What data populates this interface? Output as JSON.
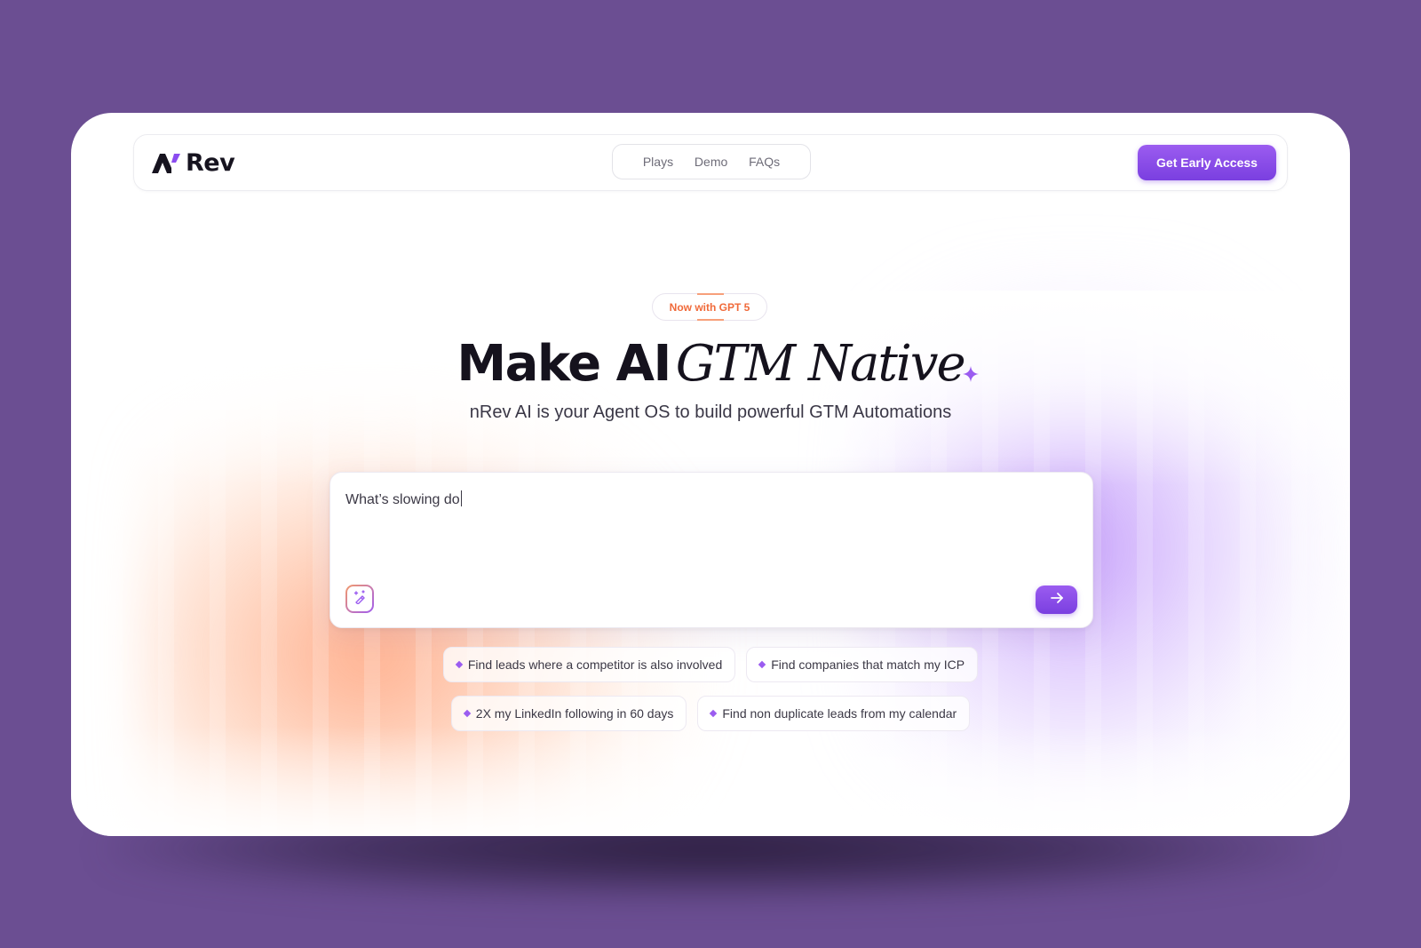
{
  "nav": {
    "logo_text": "Rev",
    "links": [
      "Plays",
      "Demo",
      "FAQs"
    ],
    "cta_label": "Get Early Access"
  },
  "hero": {
    "badge": "Now with GPT 5",
    "headline_main": "Make AI",
    "headline_accent": "GTM Native",
    "subhead": "nRev AI is your Agent OS to build powerful GTM Automations"
  },
  "prompt": {
    "value": "What’s slowing do"
  },
  "suggestions": [
    "Find leads where a competitor is also involved",
    "Find companies that match my ICP",
    "2X my LinkedIn following in 60 days",
    "Find non duplicate leads from my calendar"
  ],
  "colors": {
    "background": "#6b4e92",
    "accent": "#8b4cf0",
    "badge_text": "#f06a3a",
    "headline": "#15121d"
  },
  "icons": {
    "logo_mark": "n-slash-logo-icon",
    "sparkle": "sparkle-icon",
    "magic": "magic-wand-icon",
    "send": "arrow-right-icon",
    "chip_bullet": "diamond-icon"
  }
}
